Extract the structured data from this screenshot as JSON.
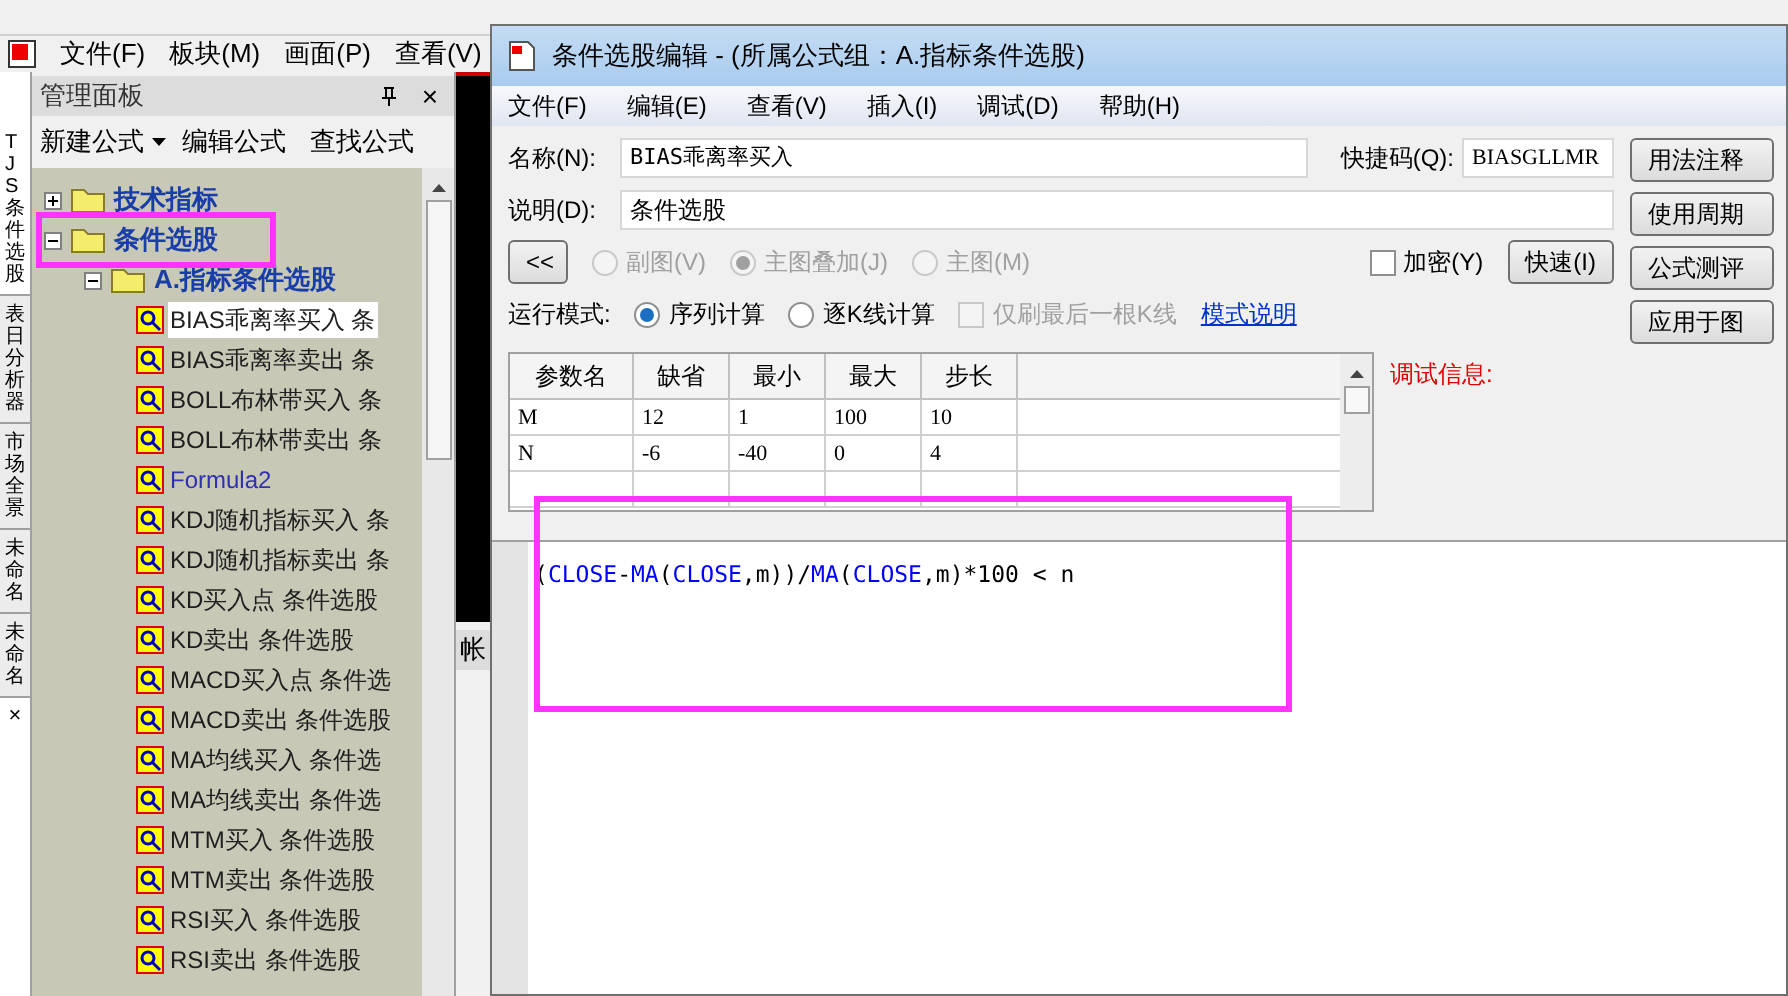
{
  "app": {
    "menu": [
      "文件(F)",
      "板块(M)",
      "画面(P)",
      "查看(V)"
    ],
    "side_tabs": [
      {
        "label": "TJS条件选股",
        "selected": true
      },
      {
        "label": "表日分析器",
        "selected": false
      },
      {
        "label": "市场全景",
        "selected": false
      },
      {
        "label": "未命名",
        "selected": false
      },
      {
        "label": "未命名",
        "selected": false
      }
    ],
    "side_close": "×",
    "panel": {
      "title": "管理面板",
      "close": "×",
      "toolbar": [
        "新建公式",
        "编辑公式",
        "查找公式"
      ],
      "tree": [
        {
          "label": "技术指标",
          "expanded": false
        },
        {
          "label": "条件选股",
          "expanded": true,
          "children": [
            {
              "label": "A.指标条件选股",
              "expanded": true,
              "children": [
                {
                  "label": "BIAS乖离率买入 条",
                  "selected": true,
                  "kind": "formula"
                },
                {
                  "label": "BIAS乖离率卖出 条",
                  "selected": false,
                  "kind": "formula"
                },
                {
                  "label": "BOLL布林带买入 条",
                  "selected": false,
                  "kind": "formula"
                },
                {
                  "label": "BOLL布林带卖出 条",
                  "selected": false,
                  "kind": "formula"
                },
                {
                  "label": "Formula2",
                  "selected": false,
                  "kind": "user"
                },
                {
                  "label": "KDJ随机指标买入 条",
                  "selected": false,
                  "kind": "formula"
                },
                {
                  "label": "KDJ随机指标卖出 条",
                  "selected": false,
                  "kind": "formula"
                },
                {
                  "label": "KD买入点 条件选股",
                  "selected": false,
                  "kind": "formula"
                },
                {
                  "label": "KD卖出 条件选股",
                  "selected": false,
                  "kind": "formula"
                },
                {
                  "label": "MACD买入点 条件选",
                  "selected": false,
                  "kind": "formula"
                },
                {
                  "label": "MACD卖出 条件选股",
                  "selected": false,
                  "kind": "formula"
                },
                {
                  "label": "MA均线买入 条件选",
                  "selected": false,
                  "kind": "formula"
                },
                {
                  "label": "MA均线卖出 条件选",
                  "selected": false,
                  "kind": "formula"
                },
                {
                  "label": "MTM买入 条件选股",
                  "selected": false,
                  "kind": "formula"
                },
                {
                  "label": "MTM卖出 条件选股",
                  "selected": false,
                  "kind": "formula"
                },
                {
                  "label": "RSI买入 条件选股",
                  "selected": false,
                  "kind": "formula"
                },
                {
                  "label": "RSI卖出 条件选股",
                  "selected": false,
                  "kind": "formula"
                }
              ]
            }
          ]
        }
      ]
    },
    "side_label": "帐"
  },
  "dialog": {
    "title": "条件选股编辑 - (所属公式组：A.指标条件选股)",
    "menu": [
      "文件(F)",
      "编辑(E)",
      "查看(V)",
      "插入(I)",
      "调试(D)",
      "帮助(H)"
    ],
    "name_label": "名称(N):",
    "name_value": "BIAS乖离率买入",
    "code_label": "快捷码(Q):",
    "code_value": "BIASGLLMR",
    "desc_label": "说明(D):",
    "desc_value": "条件选股",
    "collapse_button": "<<",
    "chart_options": [
      {
        "label": "副图(V)",
        "selected": false
      },
      {
        "label": "主图叠加(J)",
        "selected": true
      },
      {
        "label": "主图(M)",
        "selected": false
      }
    ],
    "chart_options_disabled": true,
    "encrypt": {
      "label": "加密(Y)",
      "checked": false
    },
    "fast_button": "快速(I)",
    "mode_label": "运行模式:",
    "modes": [
      {
        "label": "序列计算",
        "selected": true
      },
      {
        "label": "逐K线计算",
        "selected": false
      }
    ],
    "refresh_last": {
      "label": "仅刷最后一根K线",
      "checked": false,
      "disabled": true
    },
    "mode_link": "模式说明",
    "debug_label": "调试信息:",
    "side_buttons": [
      "用法注释",
      "使用周期",
      "公式测评",
      "应用于图"
    ],
    "table": {
      "columns": [
        "参数名",
        "缺省",
        "最小",
        "最大",
        "步长"
      ],
      "rows": [
        [
          "M",
          "12",
          "1",
          "100",
          "10"
        ],
        [
          "N",
          "-6",
          "-40",
          "0",
          "4"
        ]
      ]
    },
    "code": [
      {
        "text": "(",
        "kind": "plain"
      },
      {
        "text": "CLOSE",
        "kind": "keyword"
      },
      {
        "text": "-",
        "kind": "plain"
      },
      {
        "text": "MA",
        "kind": "keyword"
      },
      {
        "text": "(",
        "kind": "plain"
      },
      {
        "text": "CLOSE",
        "kind": "keyword"
      },
      {
        "text": ",m))/",
        "kind": "plain"
      },
      {
        "text": "MA",
        "kind": "keyword"
      },
      {
        "text": "(",
        "kind": "plain"
      },
      {
        "text": "CLOSE",
        "kind": "keyword"
      },
      {
        "text": ",m)*100 < n",
        "kind": "plain"
      }
    ]
  }
}
